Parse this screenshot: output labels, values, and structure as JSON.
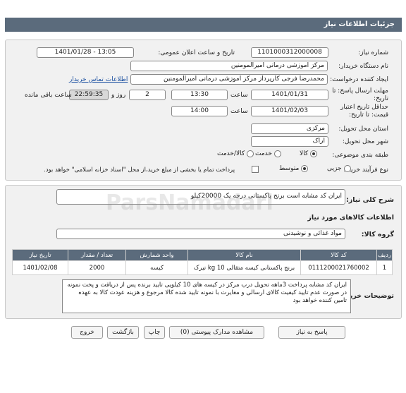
{
  "header": {
    "title": "جزئیات اطلاعات نیاز"
  },
  "form": {
    "need_number": {
      "label": "شماره نیاز:",
      "value": "1101000312000008"
    },
    "announce_datetime": {
      "label": "تاریخ و ساعت اعلان عمومی:",
      "value": "1401/01/28 - 13:05"
    },
    "buyer_org": {
      "label": "نام دستگاه خریدار:",
      "value": "مرکز اموزشی درمانی امیرالمومنین"
    },
    "requester": {
      "label": "ایجاد کننده درخواست:",
      "value": "محمدرضا فرجی کارپرداز مرکز اموزشی درمانی امیرالمومنین",
      "contact_link": "اطلاعات تماس خریدار"
    },
    "reply_deadline": {
      "label": "مهلت ارسال پاسخ: تا تاریخ:",
      "date": "1401/01/31",
      "time_label": "ساعت",
      "time": "13:30",
      "days": "2",
      "days_label": "روز و",
      "remaining": "22:59:35",
      "remaining_label": "ساعت باقی مانده"
    },
    "price_validity": {
      "label": "حداقل تاریخ اعتبار قیمت: تا تاریخ:",
      "date": "1401/02/03",
      "time_label": "ساعت",
      "time": "14:00"
    },
    "province": {
      "label": "استان محل تحویل:",
      "value": "مرکزی"
    },
    "city": {
      "label": "شهر محل تحویل:",
      "value": "اراک"
    },
    "category": {
      "label": "طبقه بندی موضوعی:",
      "options": [
        "کالا",
        "خدمت",
        "کالا/خدمت"
      ],
      "selected": "کالا"
    },
    "process": {
      "label": "نوع فرآیند خرید :",
      "options": [
        "جزیی",
        "متوسط"
      ],
      "selected": "متوسط",
      "payment_note": "پرداخت تمام یا بخشی از مبلغ خرید،از محل \"اسناد خزانه اسلامی\" خواهد بود."
    }
  },
  "summary": {
    "label": "شرح کلی نیاز:",
    "value": "ایران کد مشابه است برنج پاکستانی درجه یک 20000کیلو"
  },
  "goods_section": {
    "title": "اطلاعات کالاهای مورد نیاز"
  },
  "goods_group": {
    "label": "گروه کالا:",
    "value": "مواد غذائی و نوشیدنی"
  },
  "table": {
    "headers": [
      "ردیف",
      "کد کالا",
      "نام کالا",
      "واحد شمارش",
      "تعداد / مقدار",
      "تاریخ نیاز"
    ],
    "rows": [
      [
        "1",
        "0111200021760002",
        "برنج پاکستانی کیسه متقالی 10 kg تیرک",
        "کیسه",
        "2000",
        "1401/02/08"
      ]
    ]
  },
  "buyer_notes": {
    "label": "توضیحات خریدار:",
    "value": "ایران کد مشابه پرداخت 3ماهه تحویل درب مرکز در کیسه های 10 کیلویی تایید برنده پس از دریافت و پخت نمونه در صورت عدم تایید کیفیت کالای ارسالی و مغایرت با نمونه تایید شده کالا مرجوع و هزینه عودت کالا به عهده تامین کننده خواهد بود"
  },
  "buttons": {
    "reply": "پاسخ به نیاز",
    "view_docs": "مشاهده مدارک پیوستی (0)",
    "print": "چاپ",
    "back": "بازگشت",
    "exit": "خروج"
  },
  "watermark": {
    "text": "ParsNamadarl"
  }
}
